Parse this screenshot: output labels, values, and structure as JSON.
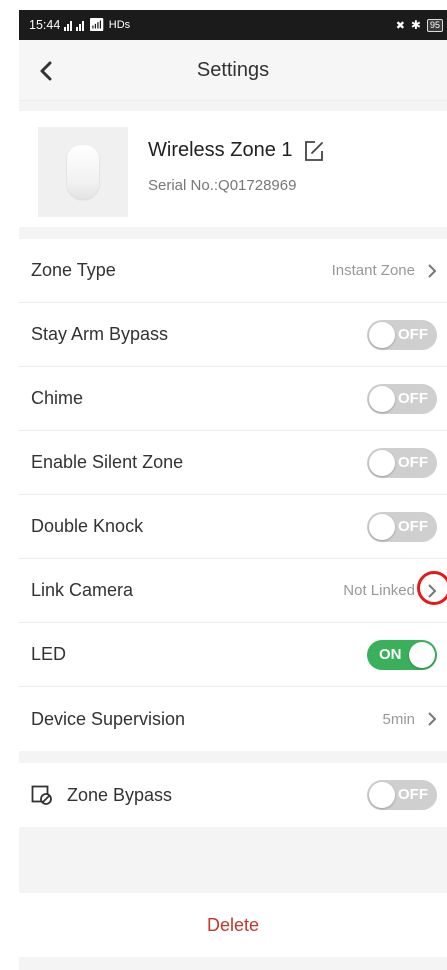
{
  "status_bar": {
    "time": "15:44",
    "network": "HDs",
    "battery": "95"
  },
  "header": {
    "title": "Settings"
  },
  "device": {
    "name": "Wireless Zone 1",
    "serial": "Serial No.:Q01728969"
  },
  "settings": {
    "zone_type": {
      "label": "Zone Type",
      "value": "Instant Zone"
    },
    "stay_arm_bypass": {
      "label": "Stay Arm Bypass",
      "toggle": "OFF"
    },
    "chime": {
      "label": "Chime",
      "toggle": "OFF"
    },
    "silent_zone": {
      "label": "Enable Silent Zone",
      "toggle": "OFF"
    },
    "double_knock": {
      "label": "Double Knock",
      "toggle": "OFF"
    },
    "link_camera": {
      "label": "Link Camera",
      "value": "Not Linked"
    },
    "led": {
      "label": "LED",
      "toggle": "ON"
    },
    "device_supervision": {
      "label": "Device Supervision",
      "value": "5min"
    }
  },
  "zone_bypass": {
    "label": "Zone Bypass",
    "toggle": "OFF"
  },
  "delete_label": "Delete",
  "colors": {
    "toggle_on": "#3ab05a",
    "toggle_off": "#cfcfcf",
    "delete": "#c0392b",
    "highlight": "#e11b1b"
  }
}
